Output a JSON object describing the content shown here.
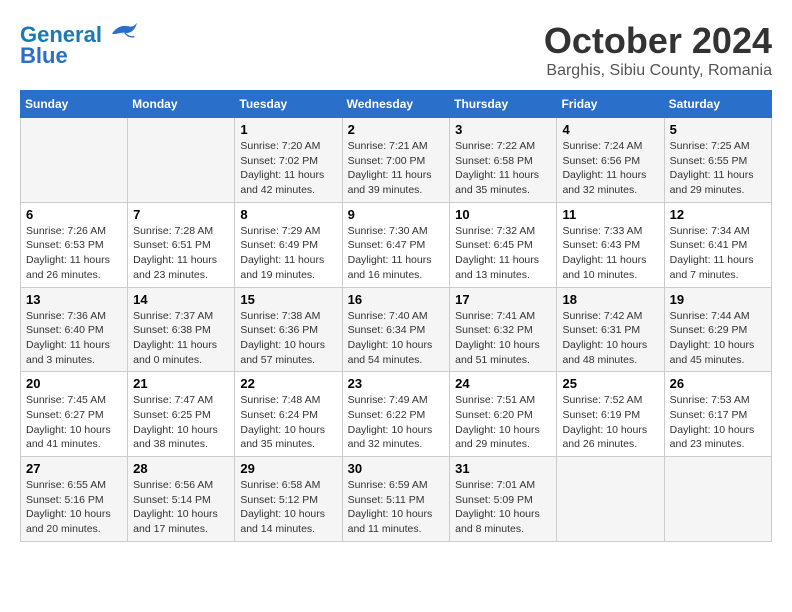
{
  "header": {
    "logo_line1": "General",
    "logo_line2": "Blue",
    "month": "October 2024",
    "location": "Barghis, Sibiu County, Romania"
  },
  "days_of_week": [
    "Sunday",
    "Monday",
    "Tuesday",
    "Wednesday",
    "Thursday",
    "Friday",
    "Saturday"
  ],
  "weeks": [
    [
      {
        "day": "",
        "content": ""
      },
      {
        "day": "",
        "content": ""
      },
      {
        "day": "1",
        "content": "Sunrise: 7:20 AM\nSunset: 7:02 PM\nDaylight: 11 hours and 42 minutes."
      },
      {
        "day": "2",
        "content": "Sunrise: 7:21 AM\nSunset: 7:00 PM\nDaylight: 11 hours and 39 minutes."
      },
      {
        "day": "3",
        "content": "Sunrise: 7:22 AM\nSunset: 6:58 PM\nDaylight: 11 hours and 35 minutes."
      },
      {
        "day": "4",
        "content": "Sunrise: 7:24 AM\nSunset: 6:56 PM\nDaylight: 11 hours and 32 minutes."
      },
      {
        "day": "5",
        "content": "Sunrise: 7:25 AM\nSunset: 6:55 PM\nDaylight: 11 hours and 29 minutes."
      }
    ],
    [
      {
        "day": "6",
        "content": "Sunrise: 7:26 AM\nSunset: 6:53 PM\nDaylight: 11 hours and 26 minutes."
      },
      {
        "day": "7",
        "content": "Sunrise: 7:28 AM\nSunset: 6:51 PM\nDaylight: 11 hours and 23 minutes."
      },
      {
        "day": "8",
        "content": "Sunrise: 7:29 AM\nSunset: 6:49 PM\nDaylight: 11 hours and 19 minutes."
      },
      {
        "day": "9",
        "content": "Sunrise: 7:30 AM\nSunset: 6:47 PM\nDaylight: 11 hours and 16 minutes."
      },
      {
        "day": "10",
        "content": "Sunrise: 7:32 AM\nSunset: 6:45 PM\nDaylight: 11 hours and 13 minutes."
      },
      {
        "day": "11",
        "content": "Sunrise: 7:33 AM\nSunset: 6:43 PM\nDaylight: 11 hours and 10 minutes."
      },
      {
        "day": "12",
        "content": "Sunrise: 7:34 AM\nSunset: 6:41 PM\nDaylight: 11 hours and 7 minutes."
      }
    ],
    [
      {
        "day": "13",
        "content": "Sunrise: 7:36 AM\nSunset: 6:40 PM\nDaylight: 11 hours and 3 minutes."
      },
      {
        "day": "14",
        "content": "Sunrise: 7:37 AM\nSunset: 6:38 PM\nDaylight: 11 hours and 0 minutes."
      },
      {
        "day": "15",
        "content": "Sunrise: 7:38 AM\nSunset: 6:36 PM\nDaylight: 10 hours and 57 minutes."
      },
      {
        "day": "16",
        "content": "Sunrise: 7:40 AM\nSunset: 6:34 PM\nDaylight: 10 hours and 54 minutes."
      },
      {
        "day": "17",
        "content": "Sunrise: 7:41 AM\nSunset: 6:32 PM\nDaylight: 10 hours and 51 minutes."
      },
      {
        "day": "18",
        "content": "Sunrise: 7:42 AM\nSunset: 6:31 PM\nDaylight: 10 hours and 48 minutes."
      },
      {
        "day": "19",
        "content": "Sunrise: 7:44 AM\nSunset: 6:29 PM\nDaylight: 10 hours and 45 minutes."
      }
    ],
    [
      {
        "day": "20",
        "content": "Sunrise: 7:45 AM\nSunset: 6:27 PM\nDaylight: 10 hours and 41 minutes."
      },
      {
        "day": "21",
        "content": "Sunrise: 7:47 AM\nSunset: 6:25 PM\nDaylight: 10 hours and 38 minutes."
      },
      {
        "day": "22",
        "content": "Sunrise: 7:48 AM\nSunset: 6:24 PM\nDaylight: 10 hours and 35 minutes."
      },
      {
        "day": "23",
        "content": "Sunrise: 7:49 AM\nSunset: 6:22 PM\nDaylight: 10 hours and 32 minutes."
      },
      {
        "day": "24",
        "content": "Sunrise: 7:51 AM\nSunset: 6:20 PM\nDaylight: 10 hours and 29 minutes."
      },
      {
        "day": "25",
        "content": "Sunrise: 7:52 AM\nSunset: 6:19 PM\nDaylight: 10 hours and 26 minutes."
      },
      {
        "day": "26",
        "content": "Sunrise: 7:53 AM\nSunset: 6:17 PM\nDaylight: 10 hours and 23 minutes."
      }
    ],
    [
      {
        "day": "27",
        "content": "Sunrise: 6:55 AM\nSunset: 5:16 PM\nDaylight: 10 hours and 20 minutes."
      },
      {
        "day": "28",
        "content": "Sunrise: 6:56 AM\nSunset: 5:14 PM\nDaylight: 10 hours and 17 minutes."
      },
      {
        "day": "29",
        "content": "Sunrise: 6:58 AM\nSunset: 5:12 PM\nDaylight: 10 hours and 14 minutes."
      },
      {
        "day": "30",
        "content": "Sunrise: 6:59 AM\nSunset: 5:11 PM\nDaylight: 10 hours and 11 minutes."
      },
      {
        "day": "31",
        "content": "Sunrise: 7:01 AM\nSunset: 5:09 PM\nDaylight: 10 hours and 8 minutes."
      },
      {
        "day": "",
        "content": ""
      },
      {
        "day": "",
        "content": ""
      }
    ]
  ]
}
